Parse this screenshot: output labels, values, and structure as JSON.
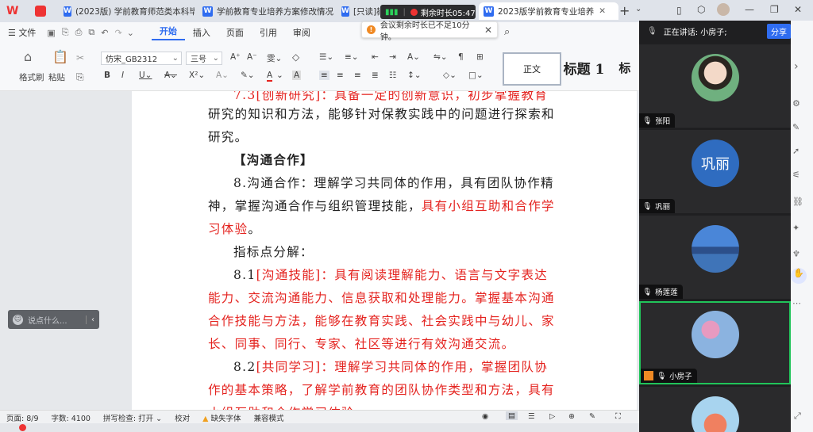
{
  "tabs": [
    {
      "label": "(2023版) 学前教育师范类本科毕"
    },
    {
      "label": "学前教育专业培养方案修改情况"
    },
    {
      "label": "[只读]教"
    },
    {
      "label": "2023版学前教育专业培养"
    }
  ],
  "timer": {
    "label": "剩余时长05:47"
  },
  "notify": {
    "text": "会议剩余时长已不足10分钟。"
  },
  "menu": {
    "file": "文件",
    "items": [
      "开始",
      "插入",
      "页面",
      "引用",
      "审阅"
    ]
  },
  "ribbon": {
    "format_painter": "格式刷",
    "paste": "粘贴",
    "font_name": "仿宋_GB2312",
    "font_size": "三号",
    "style_normal": "正文",
    "style_heading1": "标题 1",
    "style_partial": "标"
  },
  "doc": {
    "lines": [
      {
        "segs": [
          {
            "t": "7.3[创新研究]：具备一定的创新意识，初步掌握教育",
            "red": true
          }
        ]
      },
      {
        "segs": [
          {
            "t": "研究的知识和方法，能够针对保教实践中的问题进行探索和",
            "red": false
          }
        ]
      },
      {
        "segs": [
          {
            "t": "研究。",
            "red": false
          }
        ]
      },
      {
        "segs": [
          {
            "t": "【沟通合作】",
            "red": false
          }
        ]
      },
      {
        "segs": [
          {
            "t": "8.沟通合作：理解学习共同体的作用，具有团队协作精",
            "red": false
          }
        ]
      },
      {
        "segs": [
          {
            "t": "神，掌握沟通合作与组织管理技能，",
            "red": false
          },
          {
            "t": "具有小组互助和合作学",
            "red": true
          }
        ]
      },
      {
        "segs": [
          {
            "t": "习体验",
            "red": true
          },
          {
            "t": "。",
            "red": false
          }
        ]
      },
      {
        "segs": [
          {
            "t": "指标点分解：",
            "red": false
          }
        ]
      },
      {
        "segs": [
          {
            "t": "8.1",
            "red": false
          },
          {
            "t": "[沟通技能]：具有阅读理解能力、语言与文字表达",
            "red": true
          }
        ]
      },
      {
        "segs": [
          {
            "t": "能力、交流沟通能力、信息获取和处理能力。掌握基本沟通",
            "red": true
          }
        ]
      },
      {
        "segs": [
          {
            "t": "合作技能与方法，能够在教育实践、社会实践中与幼儿、家",
            "red": true
          }
        ]
      },
      {
        "segs": [
          {
            "t": "长、同事、同行、专家、社区等进行有效沟通交流。",
            "red": true
          }
        ]
      },
      {
        "segs": [
          {
            "t": "8.2",
            "red": false
          },
          {
            "t": "[共同学习]：理解学习共同体的作用，掌握团队协",
            "red": true
          }
        ]
      },
      {
        "segs": [
          {
            "t": "作的基本策略，了解学前教育的团队协作类型和方法，具有",
            "red": true
          }
        ]
      },
      {
        "segs": [
          {
            "t": "小组互助和合作学习体验。",
            "red": true
          }
        ]
      }
    ]
  },
  "chat": {
    "placeholder": "说点什么..."
  },
  "status": {
    "page": "页面: 8/9",
    "words": "字数: 4100",
    "spell": "拼写检查: 打开",
    "proof": "校对",
    "missing_font": "缺失字体",
    "compat": "兼容模式"
  },
  "meeting": {
    "speaking": "正在讲话:  小房子;",
    "share": "分享",
    "participants": [
      {
        "name": "张阳",
        "avatar": "photo-girl",
        "highlight": false
      },
      {
        "name": "巩丽",
        "avatar": "text",
        "avatar_text": "巩丽",
        "highlight": false
      },
      {
        "name": "杨莲莲",
        "avatar": "photo-lake",
        "highlight": false
      },
      {
        "name": "小房子",
        "avatar": "photo-flower",
        "highlight": true
      },
      {
        "name": "",
        "avatar": "photo-fruit",
        "highlight": false
      }
    ]
  },
  "colors": {
    "accent": "#2f6cf0",
    "red_text": "#e4231f",
    "highlight": "#21c45a",
    "avatar_blue": "#2f6cc0"
  }
}
